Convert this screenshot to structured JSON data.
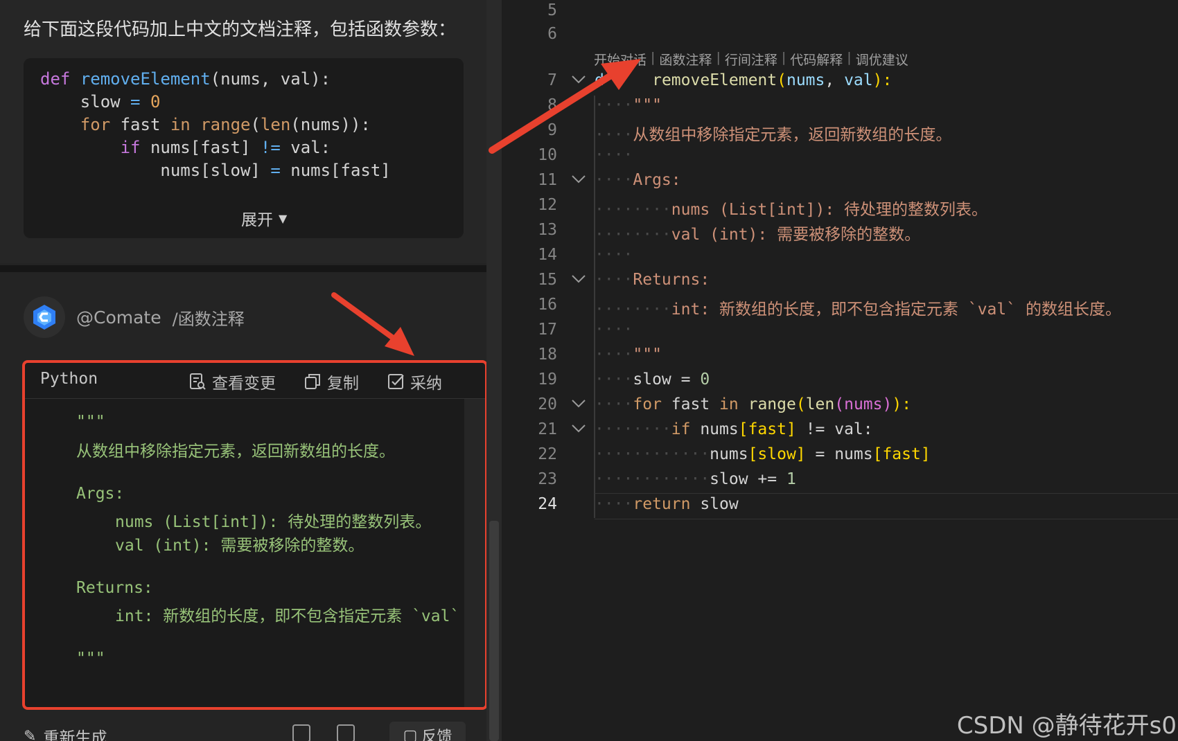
{
  "chat": {
    "prompt": "给下面这段代码加上中文的文档注释，包括函数参数：",
    "user_code": {
      "line1": {
        "kw": "def",
        "fn": "removeElement",
        "rest": "(nums, val):"
      },
      "line2": {
        "a": "slow ",
        "op": "=",
        "sp": " ",
        "num": "0"
      },
      "line3": {
        "kw": "for",
        "a": " fast ",
        "kw2": "in",
        "sp": " ",
        "fn1": "range",
        "b": "(",
        "fn2": "len",
        "c": "(nums)):"
      },
      "line4": {
        "kw": "if",
        "a": " nums[fast] ",
        "op": "!=",
        "b": " val:"
      },
      "line5": {
        "a": "nums[slow] ",
        "op": "=",
        "b": " nums[fast]"
      }
    },
    "expand_label": "展开",
    "assistant_name": "@Comate",
    "assistant_command": "/函数注释",
    "response": {
      "language": "Python",
      "actions": {
        "view_changes": "查看变更",
        "copy": "复制",
        "accept": "采纳"
      },
      "code": {
        "l1": "\"\"\"",
        "l2": "从数组中移除指定元素，返回新数组的长度。",
        "l3": "Args:",
        "l4": "nums (List[int]): 待处理的整数列表。",
        "l5": "val (int): 需要被移除的整数。",
        "l6": "Returns:",
        "l7": "int: 新数组的长度，即不包含指定元素 `val`",
        "l8": "\"\"\""
      }
    },
    "regenerate_label": "重新生成",
    "feedback_label": "反馈"
  },
  "editor": {
    "line_numbers": [
      "5",
      "6",
      "7",
      "8",
      "9",
      "10",
      "11",
      "12",
      "13",
      "14",
      "15",
      "16",
      "17",
      "18",
      "19",
      "20",
      "21",
      "22",
      "23",
      "24"
    ],
    "codelens": [
      "开始对话",
      "函数注释",
      "行间注释",
      "代码解释",
      "调优建议"
    ],
    "code": {
      "l7_kw": "d",
      "l7_fn": "removeElement",
      "l7_open": "(",
      "l7_p1": "nums",
      "l7_comma": ", ",
      "l7_p2": "val",
      "l7_close": "):",
      "l8": "\"\"\"",
      "l9": "从数组中移除指定元素，返回新数组的长度。",
      "l11": "Args:",
      "l12": "nums (List[int]): 待处理的整数列表。",
      "l13": "val (int): 需要被移除的整数。",
      "l15": "Returns:",
      "l16": "int: 新数组的长度，即不包含指定元素 `val` 的数组长度。",
      "l18": "\"\"\"",
      "l19_a": "slow = ",
      "l19_num": "0",
      "l20_kw": "for",
      "l20_a": " fast ",
      "l20_kw2": "in",
      "l20_sp": " ",
      "l20_fn1": "range",
      "l20_b": "(",
      "l20_fn2": "len",
      "l20_c": "(nums)",
      "l20_d": "):",
      "l21_kw": "if",
      "l21_a": " nums",
      "l21_b": "[fast]",
      "l21_c": " != val:",
      "l22_a": "nums",
      "l22_b": "[slow]",
      "l22_c": " = nums",
      "l22_d": "[fast]",
      "l23_a": "slow += ",
      "l23_num": "1",
      "l24_kw": "return",
      "l24_a": " slow"
    }
  },
  "watermark": "CSDN @静待花开s0",
  "colors": {
    "highlight_red": "#e8412e",
    "background": "#1e1e1e"
  }
}
